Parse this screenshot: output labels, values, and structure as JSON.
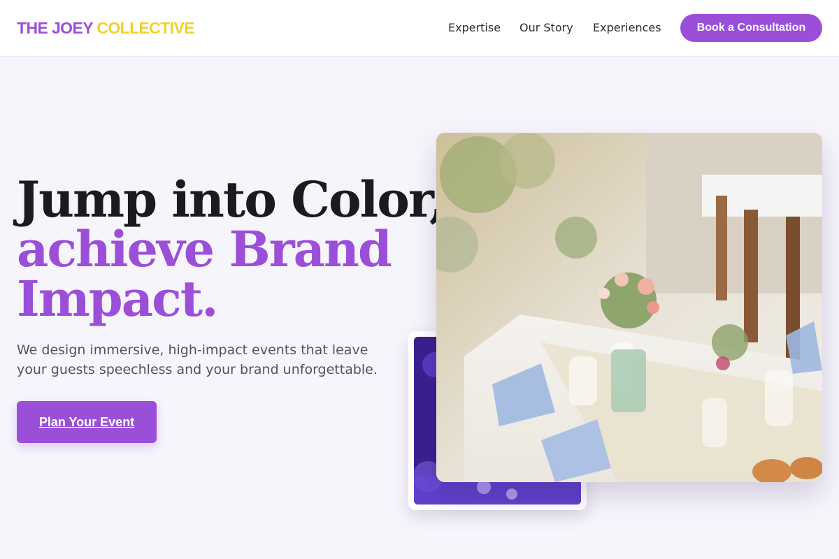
{
  "brand": {
    "part1": "THE JOEY",
    "part2": "COLLECTIVE",
    "color1": "#9b4fd9",
    "color2": "#f1d12b"
  },
  "nav": {
    "items": [
      {
        "label": "Expertise"
      },
      {
        "label": "Our Story"
      },
      {
        "label": "Experiences"
      }
    ],
    "cta_label": "Book a Consultation"
  },
  "hero": {
    "headline_line1": "Jump into Color,",
    "headline_line2": "achieve Brand",
    "headline_line3": "Impact.",
    "subtext": "We design immersive, high-impact events that leave your guests speechless and your brand unforgettable.",
    "cta_label": "Plan Your Event"
  },
  "images": {
    "main_icon": "wedding-table-photo",
    "secondary_icon": "purple-event-photo"
  },
  "colors": {
    "accent": "#9b4fd9",
    "background": "#f7f5fc",
    "text_dark": "#1b1b1f",
    "text_muted": "#4b5563"
  }
}
